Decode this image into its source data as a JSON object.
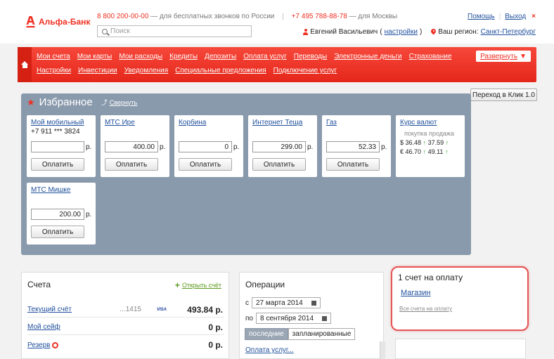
{
  "header": {
    "logo_name": "Альфа-Банк",
    "phone1": "8 800 200-00-00",
    "phone1_note": "— для бесплатных звонков по России",
    "phone2": "+7 495 788-88-78",
    "phone2_note": "— для Москвы",
    "search_placeholder": "Поиск",
    "help": "Помощь",
    "exit": "Выход",
    "user_name": "Евгений Васильевич",
    "settings": "настройки",
    "region_label": "Ваш регион:",
    "region_value": "Санкт-Петербург"
  },
  "nav": {
    "row1": [
      "Мои счета",
      "Мои карты",
      "Мои расходы",
      "Кредиты",
      "Депозиты",
      "Оплата услуг",
      "Переводы",
      "Электронные деньги",
      "Страхование"
    ],
    "row2": [
      "Настройки",
      "Инвестиции",
      "Уведомления",
      "Специальные предложения",
      "Подключение услуг"
    ],
    "expand": "Развернуть"
  },
  "klick_button": "Переход в Клик 1.0",
  "favorites": {
    "title": "Избранное",
    "collapse": "Свернуть",
    "pay_label": "Оплатить",
    "currency": "р.",
    "cards": [
      {
        "title": "Мой мобильный",
        "sub": "+7 911 *** 3824",
        "amount": ""
      },
      {
        "title": "МТС Ире",
        "sub": "",
        "amount": "400.00"
      },
      {
        "title": "Корбина",
        "sub": "",
        "amount": "0"
      },
      {
        "title": "Интернет Теща",
        "sub": "",
        "amount": "299.00"
      },
      {
        "title": "Газ",
        "sub": "",
        "amount": "52.33"
      },
      {
        "title": "МТС Мишке",
        "sub": "",
        "amount": "200.00"
      }
    ],
    "rates": {
      "title": "Курс валют",
      "buy": "покупка",
      "sell": "продажа",
      "usd_buy": "$ 36.48",
      "usd_sell": "37.59",
      "eur_buy": "€ 46.70",
      "eur_sell": "49.11"
    }
  },
  "accounts": {
    "title": "Счета",
    "open": "Открыть счёт",
    "rows": [
      {
        "name": "Текущий счёт",
        "number": "...1415",
        "balance": "493.84 р."
      },
      {
        "name": "Мой сейф",
        "number": "",
        "balance": "0 р."
      },
      {
        "name": "Резерв",
        "number": "",
        "balance": "0 р."
      }
    ],
    "visa": "VISA"
  },
  "operations": {
    "title": "Операции",
    "from_label": "с",
    "from_date": "27 марта 2014",
    "to_label": "по",
    "to_date": "8 сентября 2014",
    "tab_last": "последние",
    "tab_planned": "запланированные",
    "more": "Оплата услуг..."
  },
  "bills": {
    "title": "1 счет на оплату",
    "shop": "Магазин",
    "all": "Все счета на оплату"
  },
  "colors": {
    "brand_red": "#ef3124",
    "link_blue": "#1f4f9c",
    "fav_panel": "#8a9aad"
  }
}
